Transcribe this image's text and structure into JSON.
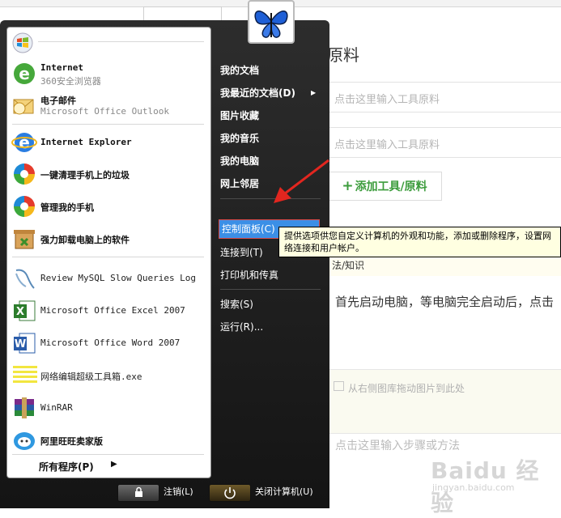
{
  "editor": {
    "section_title": "原料",
    "field1_placeholder": "点击这里输入工具原料",
    "field2_placeholder": "点击这里输入工具原料",
    "add_button": "添加工具/原料",
    "step_partial": "法/知识",
    "step_text": "首先启动电脑，等电脑完全启动后，点击",
    "image_drop": "从右侧图库拖动图片到此处",
    "step_placeholder": "点击这里输入步骤或方法",
    "watermark": "Baidu 经验",
    "watermark_url": "jingyan.baidu.com"
  },
  "start_menu": {
    "pinned": [
      {
        "name": "Internet",
        "sub": "360安全浏览器",
        "icon": "ie-green-icon"
      },
      {
        "name": "电子邮件",
        "sub": "Microsoft Office Outlook",
        "icon": "outlook-icon"
      }
    ],
    "recent": [
      {
        "name": "Internet Explorer",
        "icon": "ie-icon"
      },
      {
        "name": "一键清理手机上的垃圾",
        "icon": "phone-manager-icon"
      },
      {
        "name": "管理我的手机",
        "icon": "phone-manager-icon"
      },
      {
        "name": "强力卸载电脑上的软件",
        "icon": "uninstall-icon"
      },
      {
        "name": "Review MySQL Slow Queries Log",
        "icon": "mysql-icon"
      },
      {
        "name": "Microsoft Office Excel 2007",
        "icon": "excel-icon"
      },
      {
        "name": "Microsoft Office Word 2007",
        "icon": "word-icon"
      },
      {
        "name": "网络编辑超级工具箱.exe",
        "icon": "notepad-icon"
      },
      {
        "name": "WinRAR",
        "icon": "winrar-icon"
      },
      {
        "name": "阿里旺旺卖家版",
        "icon": "aliwangwang-icon"
      }
    ],
    "all_programs": "所有程序(P)",
    "right": {
      "my_documents": "我的文档",
      "recent_documents": "我最近的文档(D)",
      "pictures": "图片收藏",
      "music": "我的音乐",
      "my_computer": "我的电脑",
      "network": "网上邻居",
      "control_panel": "控制面板(C)",
      "connect_to": "连接到(T)",
      "printers": "打印机和传真",
      "search": "搜索(S)",
      "run": "运行(R)..."
    },
    "logoff": "注销(L)",
    "shutdown": "关闭计算机(U)",
    "tooltip": "提供选项供您自定义计算机的外观和功能，添加或删除程序，设置网络连接和用户帐户。"
  }
}
